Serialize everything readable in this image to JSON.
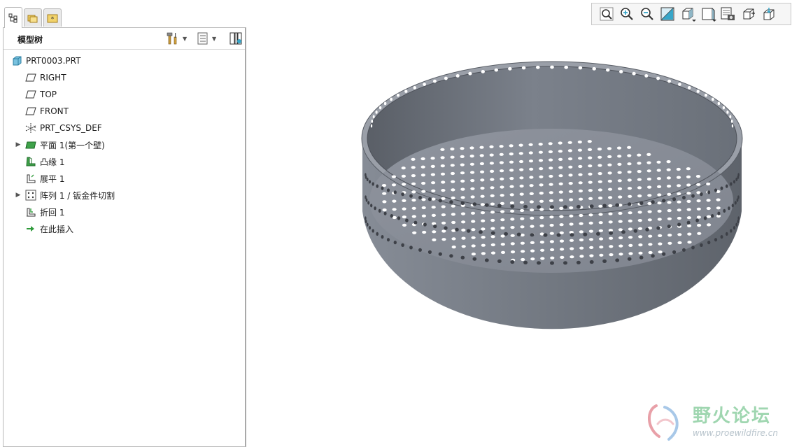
{
  "model_tree": {
    "title": "模型树",
    "root": "PRT0003.PRT",
    "items": [
      {
        "label": "RIGHT",
        "icon": "datum-plane-icon",
        "expandable": false
      },
      {
        "label": "TOP",
        "icon": "datum-plane-icon",
        "expandable": false
      },
      {
        "label": "FRONT",
        "icon": "datum-plane-icon",
        "expandable": false
      },
      {
        "label": "PRT_CSYS_DEF",
        "icon": "coordinate-system-icon",
        "expandable": false
      },
      {
        "label": "平面 1(第一个壁)",
        "icon": "planar-wall-icon",
        "expandable": true
      },
      {
        "label": "凸缘 1",
        "icon": "flange-icon",
        "expandable": false
      },
      {
        "label": "展平 1",
        "icon": "unbend-icon",
        "expandable": false
      },
      {
        "label": "阵列 1 / 钣金件切割",
        "icon": "pattern-icon",
        "expandable": true
      },
      {
        "label": "折回 1",
        "icon": "bend-back-icon",
        "expandable": false
      },
      {
        "label": "在此插入",
        "icon": "insert-here-arrow-icon",
        "expandable": false
      }
    ]
  },
  "toolbar": {
    "buttons": [
      {
        "name": "refit-button",
        "icon": "refit-icon"
      },
      {
        "name": "zoom-in-button",
        "icon": "zoom-in-icon"
      },
      {
        "name": "zoom-out-button",
        "icon": "zoom-out-icon"
      },
      {
        "name": "repaint-button",
        "icon": "repaint-icon"
      },
      {
        "name": "display-style-button",
        "icon": "display-style-icon"
      },
      {
        "name": "saved-views-button",
        "icon": "saved-views-icon"
      },
      {
        "name": "view-manager-button",
        "icon": "view-manager-icon"
      },
      {
        "name": "datum-display-button",
        "icon": "datum-display-icon"
      },
      {
        "name": "annotation-display-button",
        "icon": "annotation-display-icon"
      }
    ]
  },
  "colors": {
    "part_body": "#7f858f",
    "part_floor": "#868b96",
    "watermark_green": "#9fd6b0",
    "accent_cyan": "#37a6c9"
  },
  "watermark": {
    "title": "野火论坛",
    "url": "www.proewildfire.cn"
  }
}
